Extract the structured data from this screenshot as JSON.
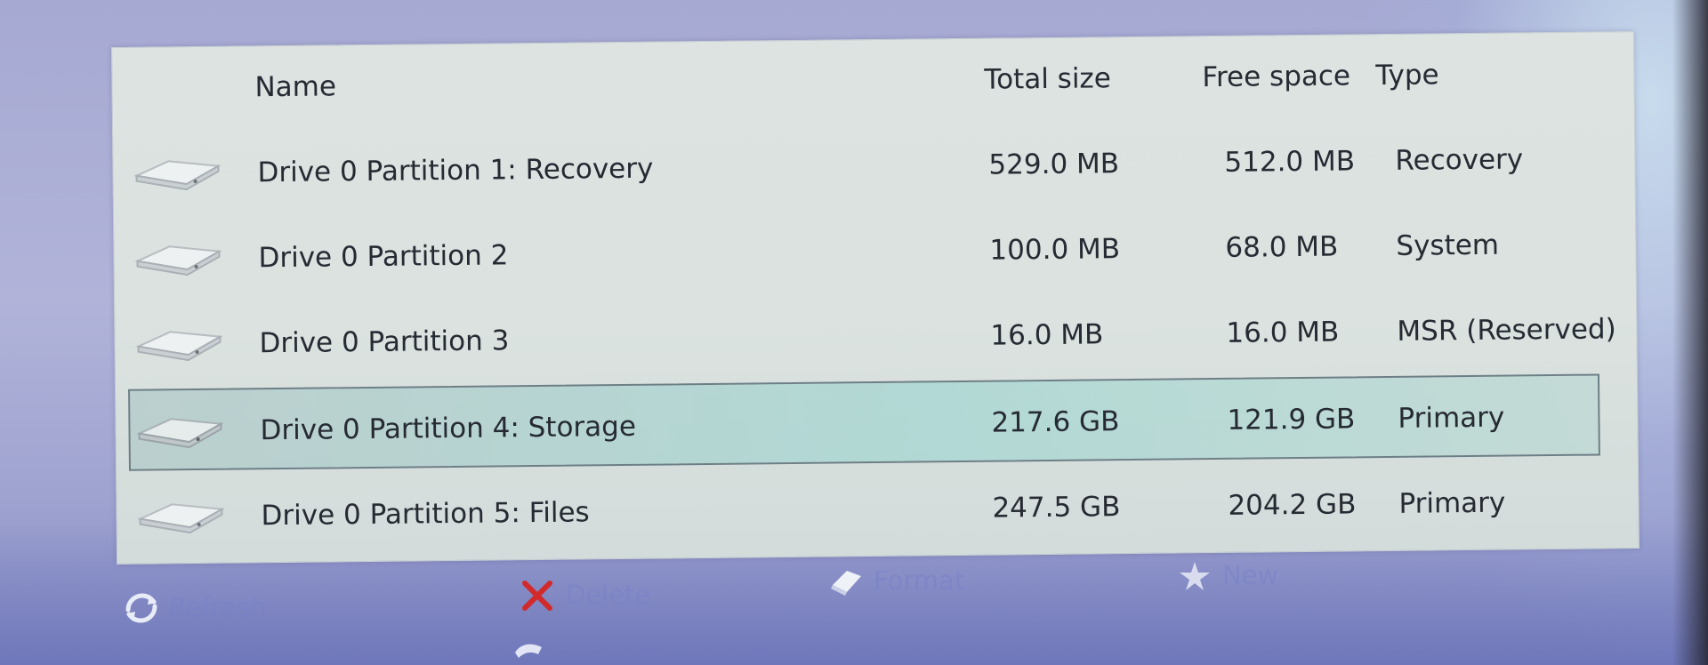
{
  "table": {
    "columns": {
      "name": "Name",
      "total_size": "Total size",
      "free_space": "Free space",
      "type": "Type"
    },
    "rows": [
      {
        "name": "Drive 0 Partition 1: Recovery",
        "total_size": "529.0 MB",
        "free_space": "512.0 MB",
        "type": "Recovery",
        "selected": false
      },
      {
        "name": "Drive 0 Partition 2",
        "total_size": "100.0 MB",
        "free_space": "68.0 MB",
        "type": "System",
        "selected": false
      },
      {
        "name": "Drive 0 Partition 3",
        "total_size": "16.0 MB",
        "free_space": "16.0 MB",
        "type": "MSR (Reserved)",
        "selected": false
      },
      {
        "name": "Drive 0 Partition 4: Storage",
        "total_size": "217.6 GB",
        "free_space": "121.9 GB",
        "type": "Primary",
        "selected": true
      },
      {
        "name": "Drive 0 Partition 5: Files",
        "total_size": "247.5 GB",
        "free_space": "204.2 GB",
        "type": "Primary",
        "selected": false
      }
    ]
  },
  "icons": {
    "row_icon": "hard-drive-icon",
    "refresh": "refresh-icon",
    "delete": "delete-x-icon",
    "format": "format-eraser-icon",
    "new": "new-star-icon",
    "extend": "extend-icon",
    "load": "load-driver-icon"
  },
  "toolbar": {
    "refresh_label": "Refresh",
    "delete_label": "Delete",
    "format_label": "Format",
    "new_label": "New"
  },
  "colors": {
    "panel_background": "#dbe2df",
    "selection_highlight": "#a5d7d2",
    "selection_border": "#6d7f86",
    "text": "#262a33",
    "screen_background": "#a6a9d2",
    "disabled_tool": "#7f88c8",
    "delete_icon": "#d22a2a"
  }
}
